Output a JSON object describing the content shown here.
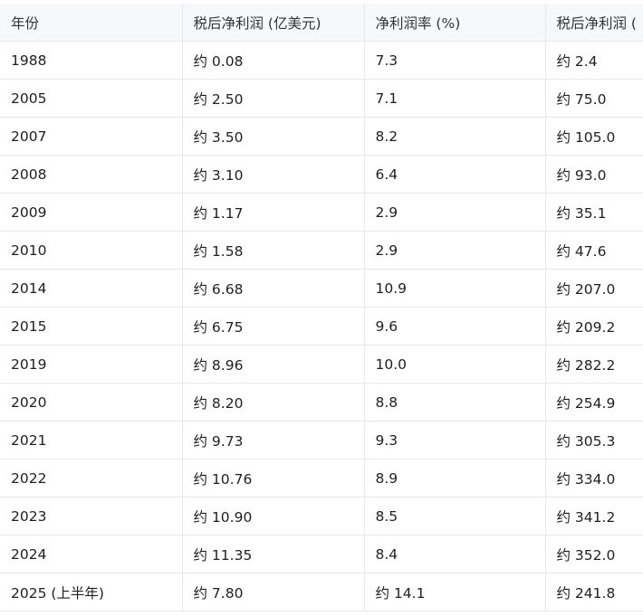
{
  "table": {
    "headers": [
      "年份",
      "税后净利润 (亿美元)",
      "净利润率 (%)",
      "税后净利润 ("
    ],
    "rows": [
      [
        "1988",
        "约 0.08",
        "7.3",
        "约 2.4"
      ],
      [
        "2005",
        "约 2.50",
        "7.1",
        "约 75.0"
      ],
      [
        "2007",
        "约 3.50",
        "8.2",
        "约 105.0"
      ],
      [
        "2008",
        "约 3.10",
        "6.4",
        "约 93.0"
      ],
      [
        "2009",
        "约 1.17",
        "2.9",
        "约 35.1"
      ],
      [
        "2010",
        "约 1.58",
        "2.9",
        "约 47.6"
      ],
      [
        "2014",
        "约 6.68",
        "10.9",
        "约 207.0"
      ],
      [
        "2015",
        "约 6.75",
        "9.6",
        "约 209.2"
      ],
      [
        "2019",
        "约 8.96",
        "10.0",
        "约 282.2"
      ],
      [
        "2020",
        "约 8.20",
        "8.8",
        "约 254.9"
      ],
      [
        "2021",
        "约 9.73",
        "9.3",
        "约 305.3"
      ],
      [
        "2022",
        "约 10.76",
        "8.9",
        "约 334.0"
      ],
      [
        "2023",
        "约 10.90",
        "8.5",
        "约 341.2"
      ],
      [
        "2024",
        "约 11.35",
        "8.4",
        "约 352.0"
      ],
      [
        "2025 (上半年)",
        "约 7.80",
        "约 14.1",
        "约 241.8"
      ]
    ]
  }
}
